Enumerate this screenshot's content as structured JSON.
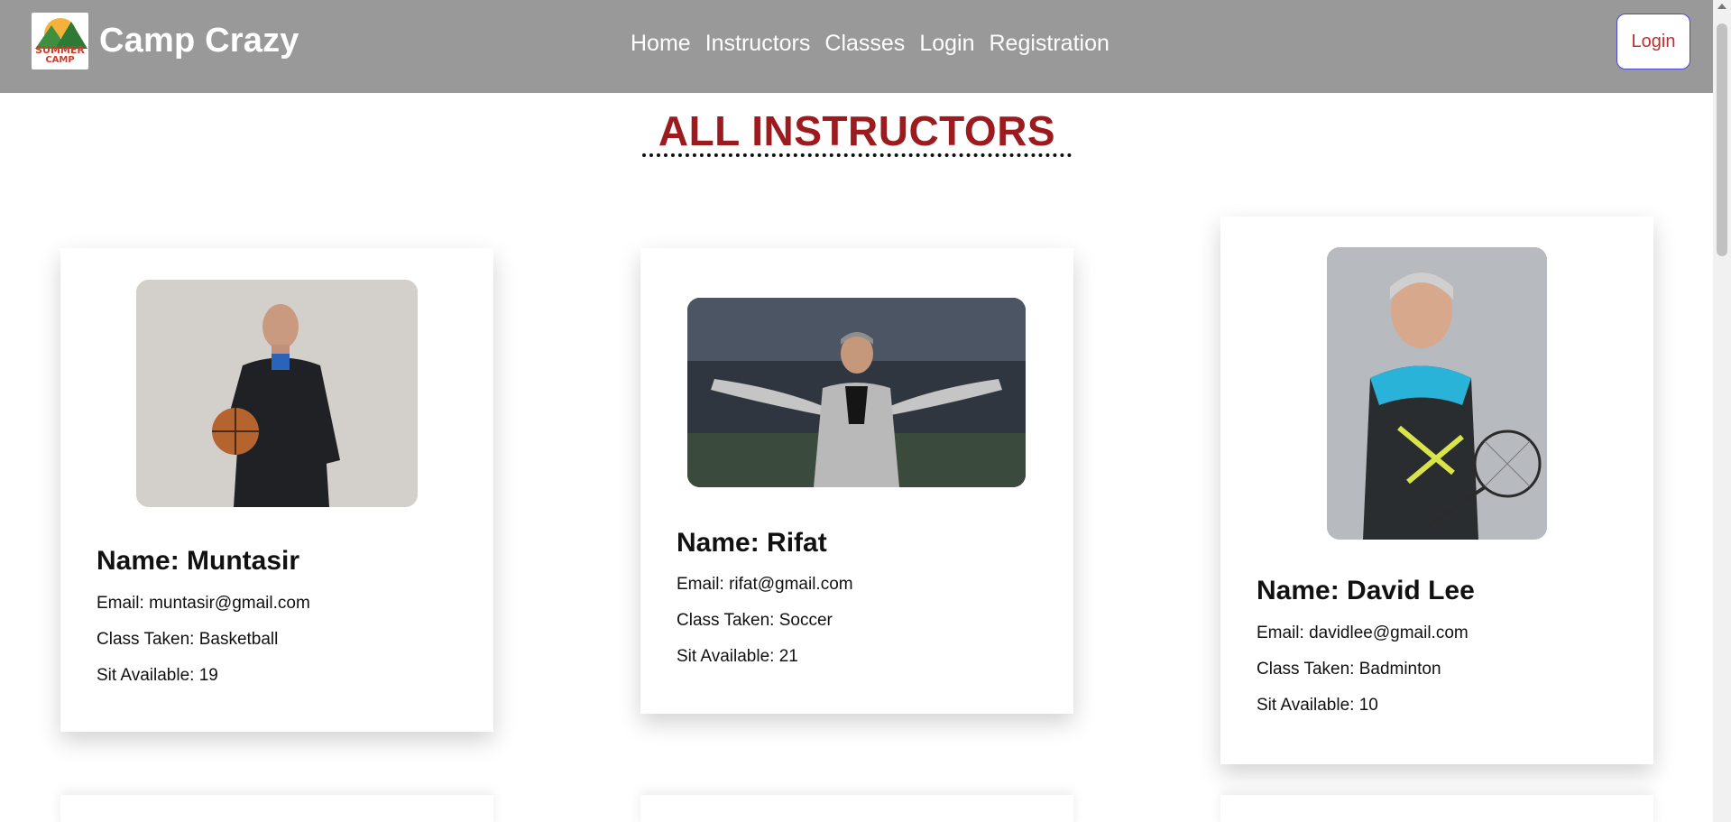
{
  "header": {
    "brand_name": "Camp Crazy",
    "logo": {
      "line1": "SUMMER",
      "line2": "CAMP"
    },
    "nav": [
      "Home",
      "Instructors",
      "Classes",
      "Login",
      "Registration"
    ],
    "login_button": "Login"
  },
  "main": {
    "title": "ALL INSTRUCTORS",
    "instructors": [
      {
        "name": "Name: Muntasir",
        "email": "Email: muntasir@gmail.com",
        "class_taken": "Class Taken: Basketball",
        "sit_available": "Sit Available: 19"
      },
      {
        "name": "Name: Rifat",
        "email": "Email: rifat@gmail.com",
        "class_taken": "Class Taken: Soccer",
        "sit_available": "Sit Available: 21"
      },
      {
        "name": "Name: David Lee",
        "email": "Email: davidlee@gmail.com",
        "class_taken": "Class Taken: Badminton",
        "sit_available": "Sit Available: 10"
      }
    ]
  },
  "colors": {
    "header_bg": "#999999",
    "title": "#9b1b1f",
    "login_text": "#c42d2d"
  }
}
